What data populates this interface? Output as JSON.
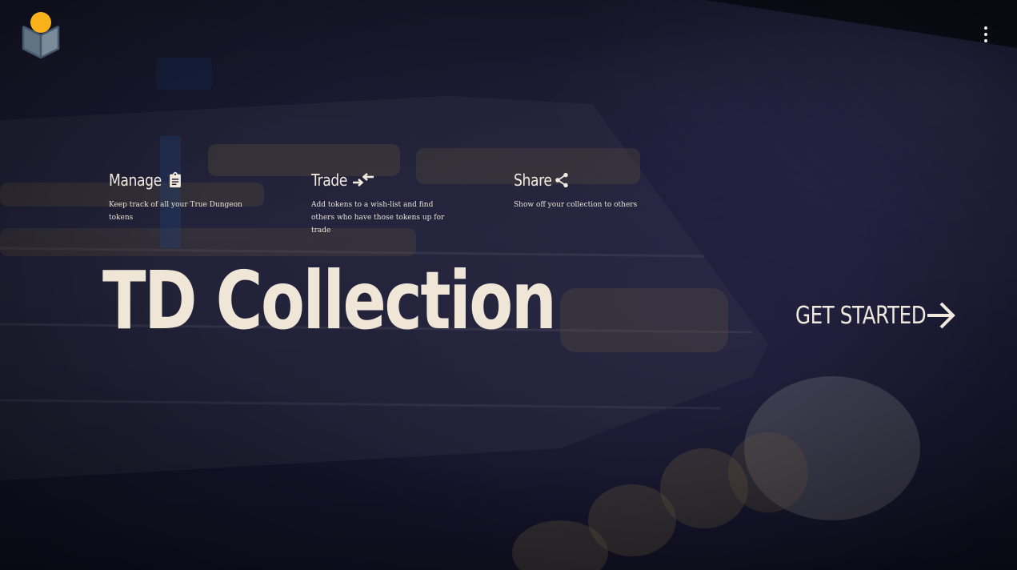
{
  "app": {
    "logo_icon": "open-box-icon",
    "menu_icon": "more-vert-icon"
  },
  "features": [
    {
      "title": "Manage",
      "icon": "clipboard-icon",
      "description": "Keep track of all your True Dungeon tokens"
    },
    {
      "title": "Trade",
      "icon": "swap-arrows-icon",
      "description": "Add tokens to a wish-list and find others who have those tokens up for trade"
    },
    {
      "title": "Share",
      "icon": "share-icon",
      "description": "Show off your collection to others"
    }
  ],
  "hero": {
    "title": "TD Collection"
  },
  "cta": {
    "label": "GET STARTED",
    "icon": "arrow-right-icon"
  },
  "colors": {
    "text": "#efe6d8",
    "logo_accent": "#f9b21a",
    "logo_box": "#6a7f8f",
    "background": "#22223d"
  }
}
